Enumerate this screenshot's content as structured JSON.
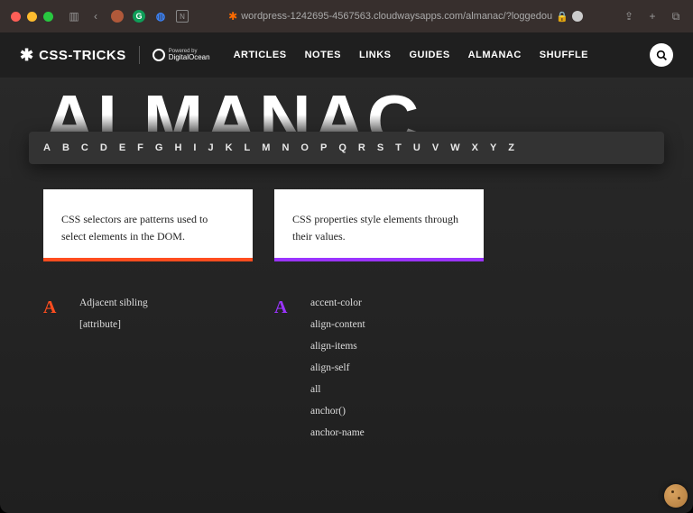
{
  "browser": {
    "url": "wordpress-1242695-4567563.cloudwaysapps.com/almanac/?loggedou"
  },
  "header": {
    "logo": "CSS-TRICKS",
    "powered_small": "Powered by",
    "powered_name": "DigitalOcean",
    "nav": {
      "articles": "ARTICLES",
      "notes": "NOTES",
      "links": "LINKS",
      "guides": "GUIDES",
      "almanac": "ALMANAC",
      "shuffle": "SHUFFLE"
    }
  },
  "hero": {
    "title": "ALMANAC"
  },
  "alpha": [
    "A",
    "B",
    "C",
    "D",
    "E",
    "F",
    "G",
    "H",
    "I",
    "J",
    "K",
    "L",
    "M",
    "N",
    "O",
    "P",
    "Q",
    "R",
    "S",
    "T",
    "U",
    "V",
    "W",
    "X",
    "Y",
    "Z"
  ],
  "cards": {
    "selectors": "CSS selectors are patterns used to select elements in the DOM.",
    "properties": "CSS properties style elements through their values."
  },
  "lists": {
    "selectors": {
      "letter": "A",
      "items": [
        "Adjacent sibling",
        "[attribute]"
      ]
    },
    "properties": {
      "letter": "A",
      "items": [
        "accent-color",
        "align-content",
        "align-items",
        "align-self",
        "all",
        "anchor()",
        "anchor-name"
      ]
    }
  }
}
